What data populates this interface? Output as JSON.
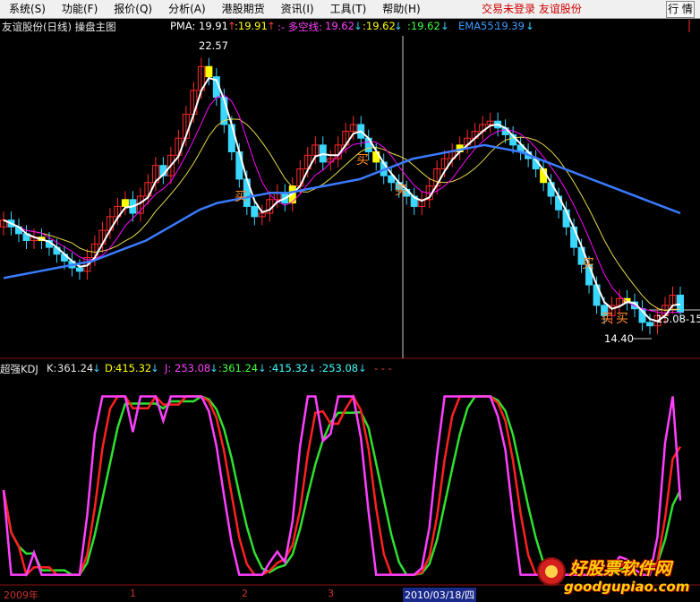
{
  "menu": {
    "items": [
      "系统(S)",
      "功能(F)",
      "报价(Q)",
      "分析(A)",
      "港股期货",
      "资讯(I)",
      "工具(T)",
      "帮助(H)"
    ],
    "status": "交易未登录  友谊股份",
    "quote_button": "行 情"
  },
  "main_chart": {
    "title": "友谊股份(日线) 操盘主图",
    "pma_label": "PMA:",
    "pma_value": "19.91",
    "pma_value2": ":19.91",
    "dk_label": ":- 多空线:",
    "dk_value": "19.62",
    "dk_value2": ":19.62",
    "dk_value3": ":19.62",
    "ema_label": "EMA55:",
    "ema_value": "19.39",
    "high_label": "22.57",
    "low_label": "14.40",
    "last_label": "15.08-15",
    "buy_label": "买",
    "colors": {
      "pma": "#ffffff",
      "dk": "#ff00ff",
      "ema": "#3a7bff",
      "slow": "#e6d84a",
      "up": "#ff2a2a",
      "down": "#3ad7ff",
      "hl": "#ffff00"
    }
  },
  "kdj": {
    "title": "超强KDJ",
    "k_label": "K:",
    "k_value": "361.24",
    "d_label": "D:",
    "d_value": "415.32",
    "j_label": "J:",
    "j_value": "253.08",
    "k_value2": ":361.24",
    "d_value2": ":415.32",
    "j_value2": ":253.08",
    "dashes": "-  -  -"
  },
  "date_axis": {
    "labels": [
      "2009年",
      "1",
      "2",
      "3",
      "2010/03/18/四"
    ]
  },
  "watermark": {
    "line1": "好股票软件网",
    "line2": "goodgupiao.com"
  },
  "chart_data": [
    {
      "type": "candlestick",
      "title": "友谊股份(日线) 操盘主图",
      "y_range": [
        13.8,
        23.2
      ],
      "close": [
        17.8,
        17.6,
        17.4,
        17.2,
        17.3,
        17.2,
        17.0,
        16.8,
        16.6,
        16.4,
        16.3,
        16.7,
        17.1,
        17.5,
        17.9,
        18.2,
        18.4,
        18.0,
        18.5,
        18.9,
        19.4,
        19.1,
        19.7,
        20.2,
        20.9,
        21.6,
        22.3,
        22.0,
        21.4,
        20.6,
        19.8,
        19.0,
        18.2,
        17.9,
        18.0,
        18.4,
        18.6,
        18.3,
        18.8,
        19.3,
        19.7,
        20.0,
        19.5,
        19.6,
        20.0,
        20.4,
        20.6,
        20.2,
        19.8,
        19.5,
        19.1,
        18.9,
        18.7,
        18.5,
        18.2,
        18.4,
        18.8,
        19.3,
        19.6,
        19.8,
        20.0,
        20.2,
        20.4,
        20.6,
        20.7,
        20.5,
        20.3,
        20.0,
        19.8,
        19.6,
        19.3,
        18.9,
        18.5,
        18.1,
        17.6,
        17.0,
        16.5,
        15.9,
        15.3,
        15.0,
        15.3,
        15.5,
        15.4,
        15.2,
        14.8,
        14.7,
        15.0,
        15.3,
        15.6,
        15.1
      ],
      "ema55": [
        16.1,
        16.2,
        16.3,
        16.4,
        16.5,
        16.6,
        16.8,
        17.0,
        17.2,
        17.5,
        17.8,
        18.1,
        18.3,
        18.4,
        18.5,
        18.6,
        18.6,
        18.7,
        18.8,
        18.9,
        19.0,
        19.2,
        19.4,
        19.6,
        19.7,
        19.8,
        19.9,
        20.0,
        19.9,
        19.8,
        19.6,
        19.4,
        19.2,
        19.0,
        18.8,
        18.6,
        18.4,
        18.2,
        18.0
      ],
      "marks": {
        "high": 22.57,
        "low": 14.4,
        "last": 15.08
      }
    },
    {
      "type": "line",
      "title": "超强KDJ",
      "series": [
        {
          "name": "K",
          "last": 361.24
        },
        {
          "name": "D",
          "last": 415.32
        },
        {
          "name": "J",
          "last": 253.08
        }
      ]
    }
  ]
}
